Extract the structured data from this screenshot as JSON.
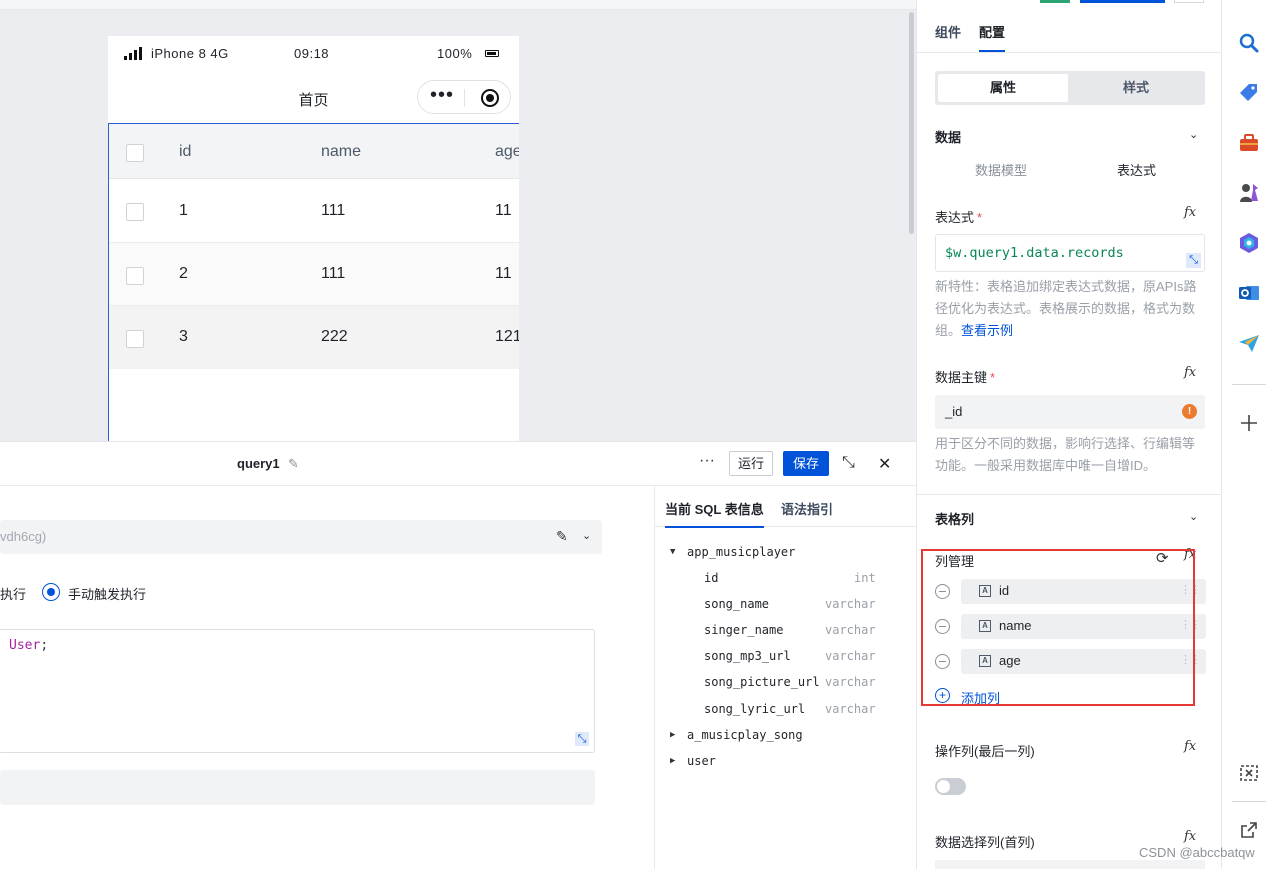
{
  "canvas": {
    "phone": {
      "carrier": "iPhone 8 4G",
      "time": "09:18",
      "battery": "100%",
      "page_title": "首页"
    },
    "table": {
      "headers": [
        "id",
        "name",
        "age"
      ],
      "rows": [
        {
          "id": "1",
          "name": "111",
          "age": "11"
        },
        {
          "id": "2",
          "name": "111",
          "age": "11"
        },
        {
          "id": "3",
          "name": "222",
          "age": "121"
        }
      ]
    }
  },
  "query_panel": {
    "query_name": "query1",
    "run_label": "运行",
    "save_label": "保存",
    "datasource_value": "vdh6cg)",
    "trigger_left_label": "执行",
    "trigger_manual_label": "手动触发执行",
    "code_keyword": "User",
    "code_semicolon": ";"
  },
  "sql_info": {
    "tab_active": "当前 SQL 表信息",
    "tab_other": "语法指引",
    "tables": [
      {
        "name": "app_musicplayer",
        "expanded": true,
        "fields": [
          {
            "name": "id",
            "type": "int"
          },
          {
            "name": "song_name",
            "type": "varchar"
          },
          {
            "name": "singer_name",
            "type": "varchar"
          },
          {
            "name": "song_mp3_url",
            "type": "varchar"
          },
          {
            "name": "song_picture_url",
            "type": "varchar"
          },
          {
            "name": "song_lyric_url",
            "type": "varchar"
          }
        ]
      },
      {
        "name": "a_musicplay_song",
        "expanded": false
      },
      {
        "name": "user",
        "expanded": false
      }
    ]
  },
  "config": {
    "tab_components": "组件",
    "tab_config": "配置",
    "seg_props": "属性",
    "seg_style": "样式",
    "section_data": "数据",
    "src_model": "数据模型",
    "src_expr": "表达式",
    "expr_label": "表达式",
    "expr_value": "$w.query1.data.records",
    "expr_help": "新特性：表格追加绑定表达式数据，原APIs路径优化为表达式。表格展示的数据，格式为数组。",
    "expr_help_link": "查看示例",
    "key_label": "数据主键",
    "key_value": "_id",
    "key_help": "用于区分不同的数据，影响行选择、行编辑等功能。一般采用数据库中唯一自增ID。",
    "section_columns": "表格列",
    "col_manage_label": "列管理",
    "columns": [
      "id",
      "name",
      "age"
    ],
    "add_column": "添加列",
    "op_col_label": "操作列(最后一列)",
    "op_col_enabled": false,
    "select_col_label": "数据选择列(首列)",
    "fx": "fx"
  },
  "colors": {
    "primary": "#0052d9",
    "highlight_box": "#e53935",
    "expr_green": "#0a8754"
  },
  "rail_icons": [
    "search-icon",
    "tag-icon",
    "toolbox-icon",
    "chess-icon",
    "copilot-icon",
    "outlook-icon",
    "send-icon",
    "add-icon",
    "screenshot-icon",
    "external-link-icon"
  ],
  "watermark": "CSDN @abccbatqw"
}
